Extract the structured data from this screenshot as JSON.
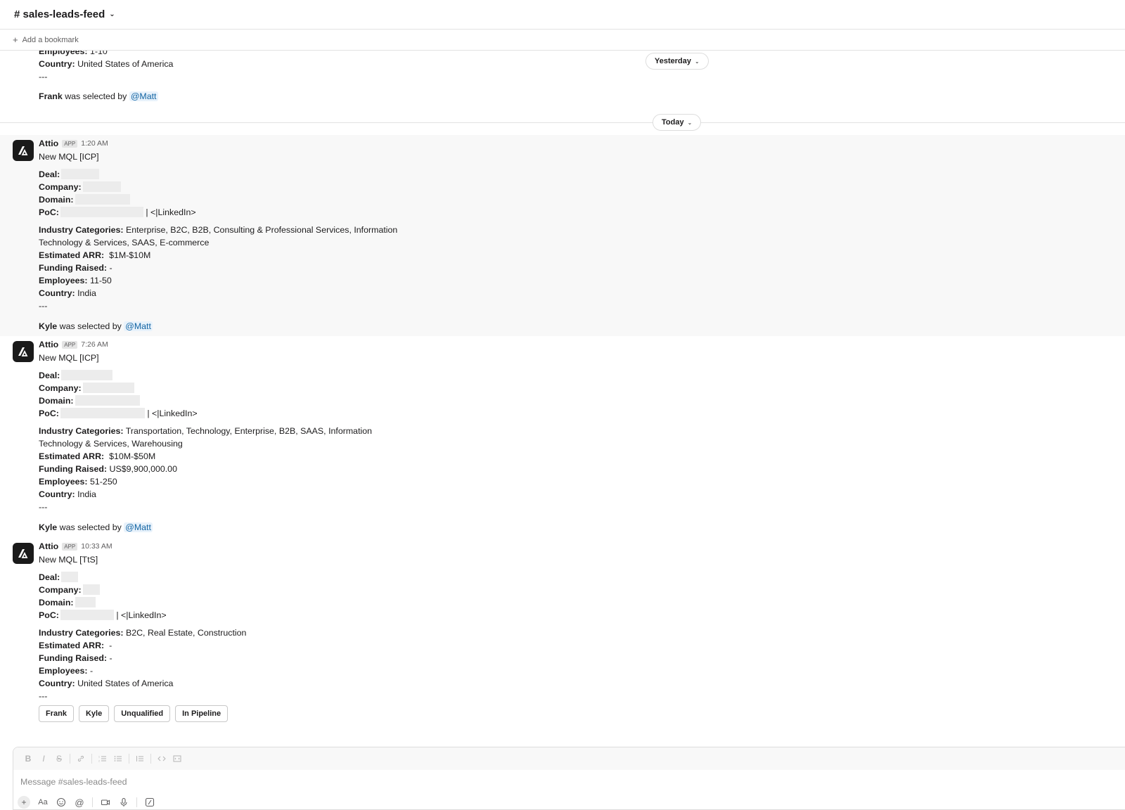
{
  "header": {
    "channel_name": "# sales-leads-feed",
    "chevron": "chevron-down-icon"
  },
  "bookmarks": {
    "add_label": "Add a bookmark"
  },
  "feed": {
    "top_partial": {
      "employees_label": "Employees:",
      "employees_value": "1-10",
      "country_label": "Country:",
      "country_value": "United States of America",
      "separator": "---",
      "selected_name": "Frank",
      "selected_text": "was selected by",
      "selected_mention": "@Matt"
    },
    "date_yesterday": "Yesterday",
    "date_today": "Today",
    "messages": [
      {
        "sender": "Attio",
        "badge": "APP",
        "time": "1:20 AM",
        "title": "New MQL [ICP]",
        "deal_label": "Deal:",
        "company_label": "Company:",
        "domain_label": "Domain:",
        "poc_label": "PoC:",
        "linkedin": "| <|LinkedIn>",
        "industry_label": "Industry Categories:",
        "industry_line1": "Enterprise, B2C, B2B, Consulting & Professional Services, Information",
        "industry_line2": "Technology & Services, SAAS, E-commerce",
        "arr_label": "Estimated ARR:",
        "arr_value": "$1M-$10M",
        "funding_label": "Funding Raised:",
        "funding_value": "-",
        "employees_label": "Employees:",
        "employees_value": "11-50",
        "country_label": "Country:",
        "country_value": "India",
        "separator": "---",
        "selected_name": "Kyle",
        "selected_text": "was selected by",
        "selected_mention": "@Matt"
      },
      {
        "sender": "Attio",
        "badge": "APP",
        "time": "7:26 AM",
        "title": "New MQL [ICP]",
        "deal_label": "Deal:",
        "company_label": "Company:",
        "domain_label": "Domain:",
        "poc_label": "PoC:",
        "linkedin": "| <|LinkedIn>",
        "industry_label": "Industry Categories:",
        "industry_line1": "Transportation, Technology, Enterprise, B2B, SAAS, Information",
        "industry_line2": "Technology & Services, Warehousing",
        "arr_label": "Estimated ARR:",
        "arr_value": "$10M-$50M",
        "funding_label": "Funding Raised:",
        "funding_value": "US$9,900,000.00",
        "employees_label": "Employees:",
        "employees_value": "51-250",
        "country_label": "Country:",
        "country_value": "India",
        "separator": "---",
        "selected_name": "Kyle",
        "selected_text": "was selected by",
        "selected_mention": "@Matt"
      },
      {
        "sender": "Attio",
        "badge": "APP",
        "time": "10:33 AM",
        "title": "New MQL [TtS]",
        "deal_label": "Deal:",
        "company_label": "Company:",
        "domain_label": "Domain:",
        "poc_label": "PoC:",
        "linkedin": "| <|LinkedIn>",
        "industry_label": "Industry Categories:",
        "industry_line1": "B2C, Real Estate, Construction",
        "arr_label": "Estimated ARR:",
        "arr_value": "-",
        "funding_label": "Funding Raised:",
        "funding_value": "-",
        "employees_label": "Employees:",
        "employees_value": "-",
        "country_label": "Country:",
        "country_value": "United States of America",
        "separator": "---",
        "buttons": [
          "Frank",
          "Kyle",
          "Unqualified",
          "In Pipeline"
        ]
      }
    ]
  },
  "composer": {
    "placeholder": "Message #sales-leads-feed",
    "format_tools": [
      "bold-icon",
      "italic-icon",
      "strikethrough-icon",
      "link-icon",
      "ordered-list-icon",
      "bulleted-list-icon",
      "blockquote-icon",
      "code-icon",
      "code-block-icon"
    ],
    "actions": [
      "plus-icon",
      "formatting-icon",
      "emoji-icon",
      "mention-icon",
      "video-icon",
      "microphone-icon",
      "slash-command-icon"
    ]
  }
}
